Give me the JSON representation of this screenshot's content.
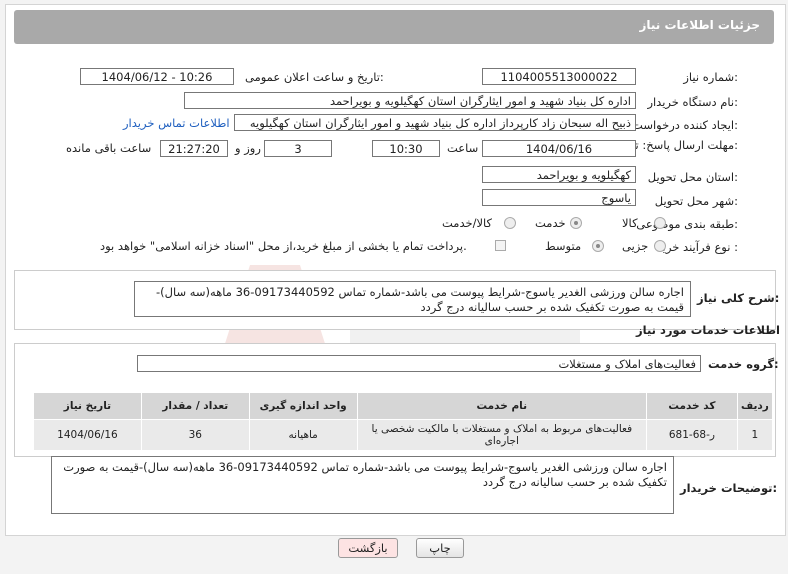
{
  "header": {
    "title": "جزئیات اطلاعات نیاز"
  },
  "fields": {
    "need_number_label": "شماره نیاز:",
    "need_number": "1104005513000022",
    "announce_label": "تاریخ و ساعت اعلان عمومی:",
    "announce_value": "1404/06/12 - 10:26",
    "buyer_org_label": "نام دستگاه خریدار:",
    "buyer_org": "اداره کل بنیاد شهید و امور ایثارگران استان کهگیلویه و بویراحمد",
    "creator_label": "ایجاد کننده درخواست:",
    "creator": "ذبیح اله سبحان زاد کارپرداز اداره کل بنیاد شهید و امور ایثارگران استان کهگیلویه",
    "buyer_contact_link": "اطلاعات تماس خریدار",
    "deadline_label": "مهلت ارسال پاسخ: تا تاریخ:",
    "deadline_date": "1404/06/16",
    "time_label": "ساعت",
    "deadline_time": "10:30",
    "days_value": "3",
    "days_and_label": "روز و",
    "remaining_time": "21:27:20",
    "remaining_label": "ساعت باقی مانده",
    "province_label": "استان محل تحویل:",
    "province": "کهگیلویه و بویراحمد",
    "city_label": "شهر محل تحویل:",
    "city": "یاسوج",
    "category_label": "طبقه بندی موضوعی:",
    "category_options": [
      "کالا",
      "خدمت",
      "کالا/خدمت"
    ],
    "category_selected": "خدمت",
    "process_label": "نوع فرآیند خرید :",
    "process_options": [
      "جزیی",
      "متوسط"
    ],
    "process_selected": "متوسط",
    "payment_note": "پرداخت تمام یا بخشی از مبلغ خرید،از محل \"اسناد خزانه اسلامی\" خواهد بود."
  },
  "summary": {
    "label": "شرح کلی نیاز:",
    "text": "اجاره سالن ورزشی الغدیر یاسوج-شرایط پیوست می باشد-شماره تماس 09173440592-36 ماهه(سه سال)-قیمت به صورت تکفیک شده بر حسب سالیانه درج گردد"
  },
  "services": {
    "title": "اطلاعات خدمات مورد نیاز",
    "group_label": "گروه خدمت:",
    "group_value": "فعالیت‌های  املاک و مستغلات",
    "columns": [
      "ردیف",
      "کد خدمت",
      "نام خدمت",
      "واحد اندازه گیری",
      "تعداد / مقدار",
      "تاریخ نیاز"
    ],
    "rows": [
      [
        "1",
        "ر-68-681",
        "فعالیت‌های مربوط به املاک و مستغلات با مالکیت شخصی یا اجاره‌ای",
        "ماهیانه",
        "36",
        "1404/06/16"
      ]
    ]
  },
  "buyer_notes": {
    "label": "توضیحات خریدار:",
    "text": "اجاره سالن ورزشی الغدیر یاسوج-شرایط پیوست می باشد-شماره تماس 09173440592-36 ماهه(سه سال)-قیمت به صورت تکفیک شده بر حسب سالیانه درج گردد"
  },
  "buttons": {
    "print": "چاپ",
    "back": "بازگشت"
  },
  "colors": {
    "header_bg": "#a9a9a9",
    "link": "#1f5fbf",
    "back_button_bg": "#fde3e3"
  }
}
